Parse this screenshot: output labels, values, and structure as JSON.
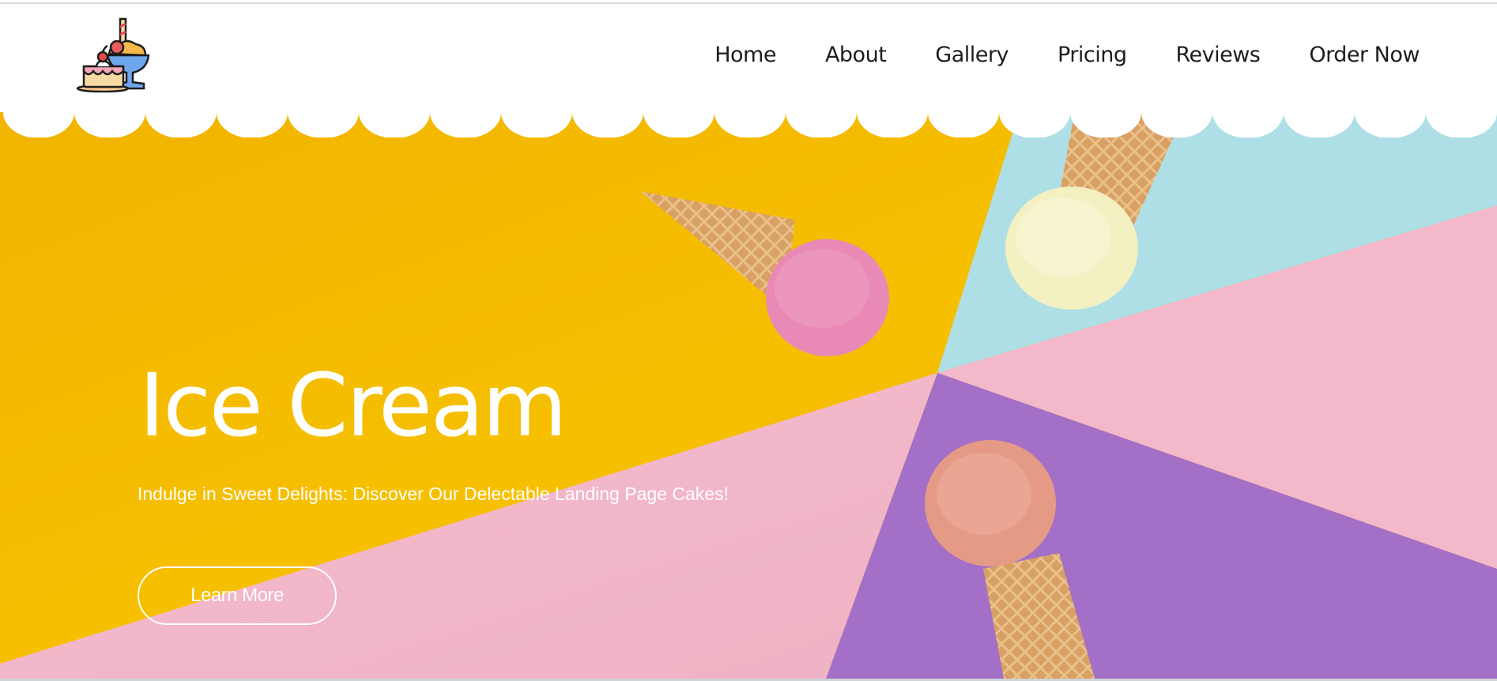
{
  "nav": {
    "items": [
      {
        "label": "Home"
      },
      {
        "label": "About"
      },
      {
        "label": "Gallery"
      },
      {
        "label": "Pricing"
      },
      {
        "label": "Reviews"
      },
      {
        "label": "Order Now"
      }
    ]
  },
  "logo": {
    "icon": "cake-and-ice-cream-cup-icon"
  },
  "hero": {
    "title": "Ice Cream",
    "subtitle": "Indulge in Sweet Delights: Discover Our Delectable Landing Page Cakes!",
    "cta_label": "Learn More",
    "image": "ice-cream-cones-on-colorful-background"
  },
  "colors": {
    "yellow": "#f4b400",
    "light_blue": "#afdfe6",
    "pink": "#f2b7c9",
    "purple": "#a46fc6",
    "text_dark": "#1d1d1d",
    "white": "#ffffff"
  }
}
